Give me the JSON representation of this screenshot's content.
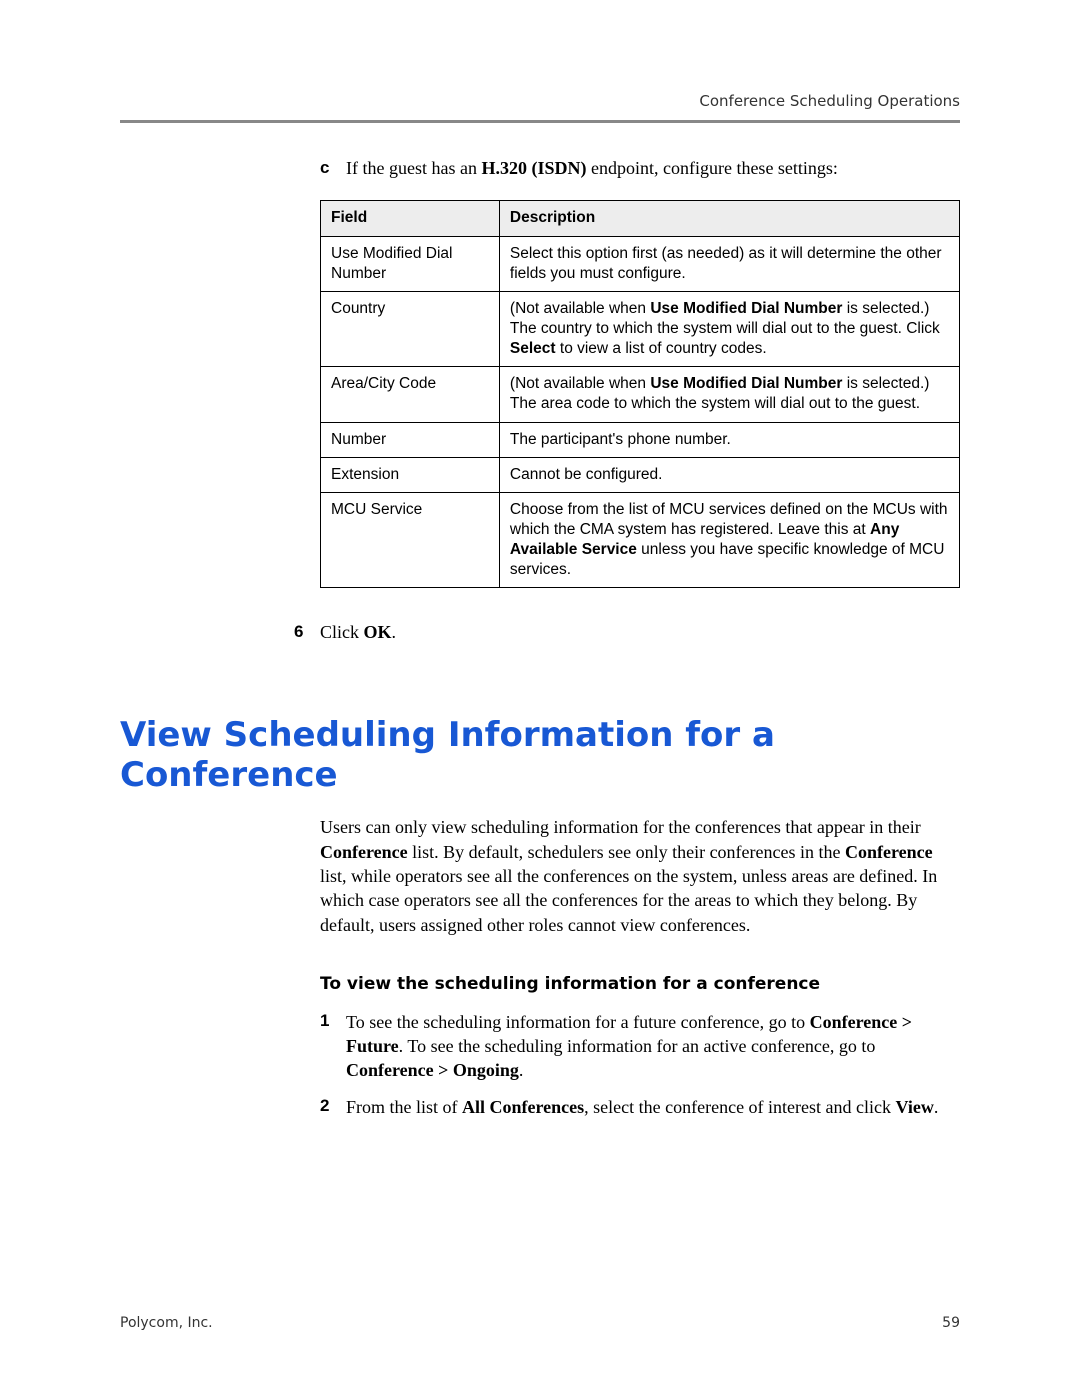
{
  "running_head": "Conference Scheduling Operations",
  "step_c": {
    "marker": "c",
    "text_before": "If the guest has an ",
    "bold": "H.320 (ISDN)",
    "text_after": " endpoint, configure these settings:"
  },
  "table": {
    "head": {
      "field": "Field",
      "desc": "Description"
    },
    "rows": [
      {
        "field": "Use Modified Dial Number",
        "desc_parts": [
          {
            "t": "Select this option first (as needed) as it will determine the other fields you must configure."
          }
        ]
      },
      {
        "field": "Country",
        "desc_parts": [
          {
            "t": "(Not available when "
          },
          {
            "b": "Use Modified Dial Number"
          },
          {
            "t": " is selected.) The country to which the system will dial out to the guest. Click "
          },
          {
            "b": "Select"
          },
          {
            "t": " to view a list of country codes."
          }
        ]
      },
      {
        "field": "Area/City Code",
        "desc_parts": [
          {
            "t": "(Not available when "
          },
          {
            "b": "Use Modified Dial Number"
          },
          {
            "t": " is selected.) The area code to which the system will dial out to the guest."
          }
        ]
      },
      {
        "field": "Number",
        "desc_parts": [
          {
            "t": "The participant's phone number."
          }
        ]
      },
      {
        "field": "Extension",
        "desc_parts": [
          {
            "t": "Cannot be configured."
          }
        ]
      },
      {
        "field": "MCU Service",
        "desc_parts": [
          {
            "t": "Choose from the list of MCU services defined on the MCUs with which the CMA system has registered. Leave this at "
          },
          {
            "b": "Any Available Service"
          },
          {
            "t": " unless you have specific knowledge of MCU services."
          }
        ]
      }
    ]
  },
  "step6": {
    "marker": "6",
    "pre": "Click ",
    "bold": "OK",
    "post": "."
  },
  "section_title": "View Scheduling Information for a Conference",
  "intro_parts": [
    {
      "t": "Users can only view scheduling information for the conferences that appear in their "
    },
    {
      "b": "Conference"
    },
    {
      "t": " list. By default, schedulers see only their conferences in the "
    },
    {
      "b": "Conference"
    },
    {
      "t": " list, while operators see all the conferences on the system, unless areas are defined. In which case operators see all the conferences for the areas to which they belong. By default, users assigned other roles cannot view conferences."
    }
  ],
  "subhead": "To view the scheduling information for a conference",
  "steps": [
    {
      "n": "1",
      "parts": [
        {
          "t": "To see the scheduling information for a future conference, go to "
        },
        {
          "b": "Conference > Future"
        },
        {
          "t": ". To see the scheduling information for an active conference, go to "
        },
        {
          "b": "Conference > Ongoing"
        },
        {
          "t": "."
        }
      ]
    },
    {
      "n": "2",
      "parts": [
        {
          "t": "From the list of "
        },
        {
          "b": "All Conferences"
        },
        {
          "t": ", select the conference of interest and click "
        },
        {
          "b": "View"
        },
        {
          "t": "."
        }
      ]
    }
  ],
  "footer": {
    "left": "Polycom, Inc.",
    "right": "59"
  }
}
